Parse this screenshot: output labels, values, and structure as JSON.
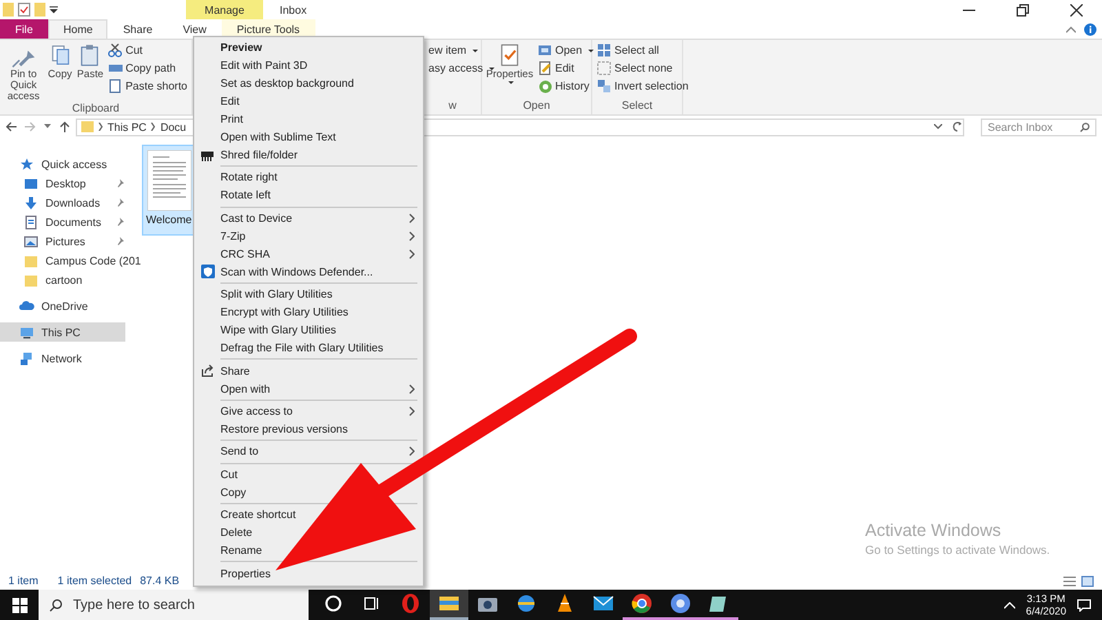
{
  "title_bar": {
    "tab_group": "Manage",
    "title": "Inbox"
  },
  "ribbon_tabs": [
    {
      "label": "File",
      "kind": "file",
      "selected": false
    },
    {
      "label": "Home",
      "kind": "tab",
      "selected": true
    },
    {
      "label": "Share",
      "kind": "tab",
      "selected": false
    },
    {
      "label": "View",
      "kind": "tab",
      "selected": false
    },
    {
      "label": "Picture Tools",
      "kind": "tab",
      "selected": false
    }
  ],
  "ribbon_groups": [
    {
      "kind": "clipboard",
      "label": "Clipboard",
      "large": [
        {
          "label": "Pin to Quick access",
          "dropdown": false
        },
        {
          "label": "Copy",
          "dropdown": false
        },
        {
          "label": "Paste",
          "dropdown": false
        }
      ],
      "small": [
        {
          "label": "Cut",
          "dropdown": false
        },
        {
          "label": "Copy path",
          "dropdown": false
        },
        {
          "label": "Paste shorto",
          "dropdown": false
        }
      ]
    },
    {
      "kind": "new",
      "label": "w",
      "small": [
        {
          "label": "ew item",
          "dropdown": true
        },
        {
          "label": "asy access",
          "dropdown": true
        }
      ]
    },
    {
      "kind": "open",
      "label": "Open",
      "large": [
        {
          "label": "Properties",
          "dropdown": true
        }
      ],
      "small": [
        {
          "label": "Open",
          "dropdown": true
        },
        {
          "label": "Edit",
          "dropdown": false
        },
        {
          "label": "History",
          "dropdown": false
        }
      ]
    },
    {
      "kind": "select",
      "label": "Select",
      "small": [
        {
          "label": "Select all",
          "dropdown": false
        },
        {
          "label": "Select none",
          "dropdown": false
        },
        {
          "label": "Invert selection",
          "dropdown": false
        }
      ]
    }
  ],
  "address": {
    "crumbs": [
      "This PC",
      "Docu"
    ],
    "search_placeholder": "Search Inbox"
  },
  "sidebar": [
    {
      "label": "Quick access",
      "kind": "quick-access",
      "selected": false,
      "children": [
        {
          "label": "Desktop",
          "kind": "desktop",
          "pinned": true,
          "selected": false
        },
        {
          "label": "Downloads",
          "kind": "downloads",
          "pinned": true,
          "selected": false
        },
        {
          "label": "Documents",
          "kind": "documents",
          "pinned": true,
          "selected": false
        },
        {
          "label": "Pictures",
          "kind": "pictures",
          "pinned": true,
          "selected": false
        },
        {
          "label": "Campus Code (201",
          "kind": "folder",
          "pinned": false,
          "selected": false
        },
        {
          "label": "cartoon",
          "kind": "folder",
          "pinned": false,
          "selected": false
        }
      ]
    },
    {
      "label": "OneDrive",
      "kind": "cloud",
      "selected": false
    },
    {
      "label": "This PC",
      "kind": "computer",
      "selected": true
    },
    {
      "label": "Network",
      "kind": "network",
      "selected": false
    }
  ],
  "files": [
    {
      "name": "Welcome",
      "selected": true
    }
  ],
  "status_bar": {
    "count": "1 item",
    "selection": "1 item selected",
    "size": "87.4 KB"
  },
  "context_menu": {
    "groups": [
      [
        {
          "label": "Preview",
          "default": true,
          "submenu": false,
          "kind": "plain"
        },
        {
          "label": "Edit with Paint 3D",
          "default": false,
          "submenu": false,
          "kind": "plain"
        },
        {
          "label": "Set as desktop background",
          "default": false,
          "submenu": false,
          "kind": "plain"
        },
        {
          "label": "Edit",
          "default": false,
          "submenu": false,
          "kind": "plain"
        },
        {
          "label": "Print",
          "default": false,
          "submenu": false,
          "kind": "plain"
        },
        {
          "label": "Open with Sublime Text",
          "default": false,
          "submenu": false,
          "kind": "plain"
        },
        {
          "label": "Shred file/folder",
          "default": false,
          "submenu": false,
          "kind": "shred"
        }
      ],
      [
        {
          "label": "Rotate right",
          "default": false,
          "submenu": false,
          "kind": "plain"
        },
        {
          "label": "Rotate left",
          "default": false,
          "submenu": false,
          "kind": "plain"
        }
      ],
      [
        {
          "label": "Cast to Device",
          "default": false,
          "submenu": true,
          "kind": "plain"
        },
        {
          "label": "7-Zip",
          "default": false,
          "submenu": true,
          "kind": "plain"
        },
        {
          "label": "CRC SHA",
          "default": false,
          "submenu": true,
          "kind": "plain"
        },
        {
          "label": "Scan with Windows Defender...",
          "default": false,
          "submenu": false,
          "kind": "defender"
        }
      ],
      [
        {
          "label": "Split with Glary Utilities",
          "default": false,
          "submenu": false,
          "kind": "plain"
        },
        {
          "label": "Encrypt with Glary Utilities",
          "default": false,
          "submenu": false,
          "kind": "plain"
        },
        {
          "label": "Wipe with Glary Utilities",
          "default": false,
          "submenu": false,
          "kind": "plain"
        },
        {
          "label": "Defrag the File with Glary Utilities",
          "default": false,
          "submenu": false,
          "kind": "plain"
        }
      ],
      [
        {
          "label": "Share",
          "default": false,
          "submenu": false,
          "kind": "share"
        },
        {
          "label": "Open with",
          "default": false,
          "submenu": true,
          "kind": "plain"
        }
      ],
      [
        {
          "label": "Give access to",
          "default": false,
          "submenu": true,
          "kind": "plain"
        },
        {
          "label": "Restore previous versions",
          "default": false,
          "submenu": false,
          "kind": "plain"
        }
      ],
      [
        {
          "label": "Send to",
          "default": false,
          "submenu": true,
          "kind": "plain"
        }
      ],
      [
        {
          "label": "Cut",
          "default": false,
          "submenu": false,
          "kind": "plain"
        },
        {
          "label": "Copy",
          "default": false,
          "submenu": false,
          "kind": "plain"
        }
      ],
      [
        {
          "label": "Create shortcut",
          "default": false,
          "submenu": false,
          "kind": "plain"
        },
        {
          "label": "Delete",
          "default": false,
          "submenu": false,
          "kind": "plain"
        },
        {
          "label": "Rename",
          "default": false,
          "submenu": false,
          "kind": "plain"
        }
      ],
      [
        {
          "label": "Properties",
          "default": false,
          "submenu": false,
          "kind": "plain"
        }
      ]
    ]
  },
  "watermark": {
    "title": "Activate Windows",
    "subtitle": "Go to Settings to activate Windows."
  },
  "taskbar": {
    "search_placeholder": "Type here to search",
    "apps": [
      {
        "kind": "cortana",
        "running": false
      },
      {
        "kind": "task-view",
        "running": false
      },
      {
        "kind": "opera",
        "running": false
      },
      {
        "kind": "explorer",
        "running": true
      },
      {
        "kind": "camera",
        "running": false
      },
      {
        "kind": "globe",
        "running": false
      },
      {
        "kind": "vlc",
        "running": false
      },
      {
        "kind": "mail",
        "running": false
      },
      {
        "kind": "chrome",
        "running": true
      },
      {
        "kind": "chromium",
        "running": true
      },
      {
        "kind": "notes",
        "running": true
      }
    ],
    "time": "3:13 PM",
    "date": "6/4/2020"
  }
}
